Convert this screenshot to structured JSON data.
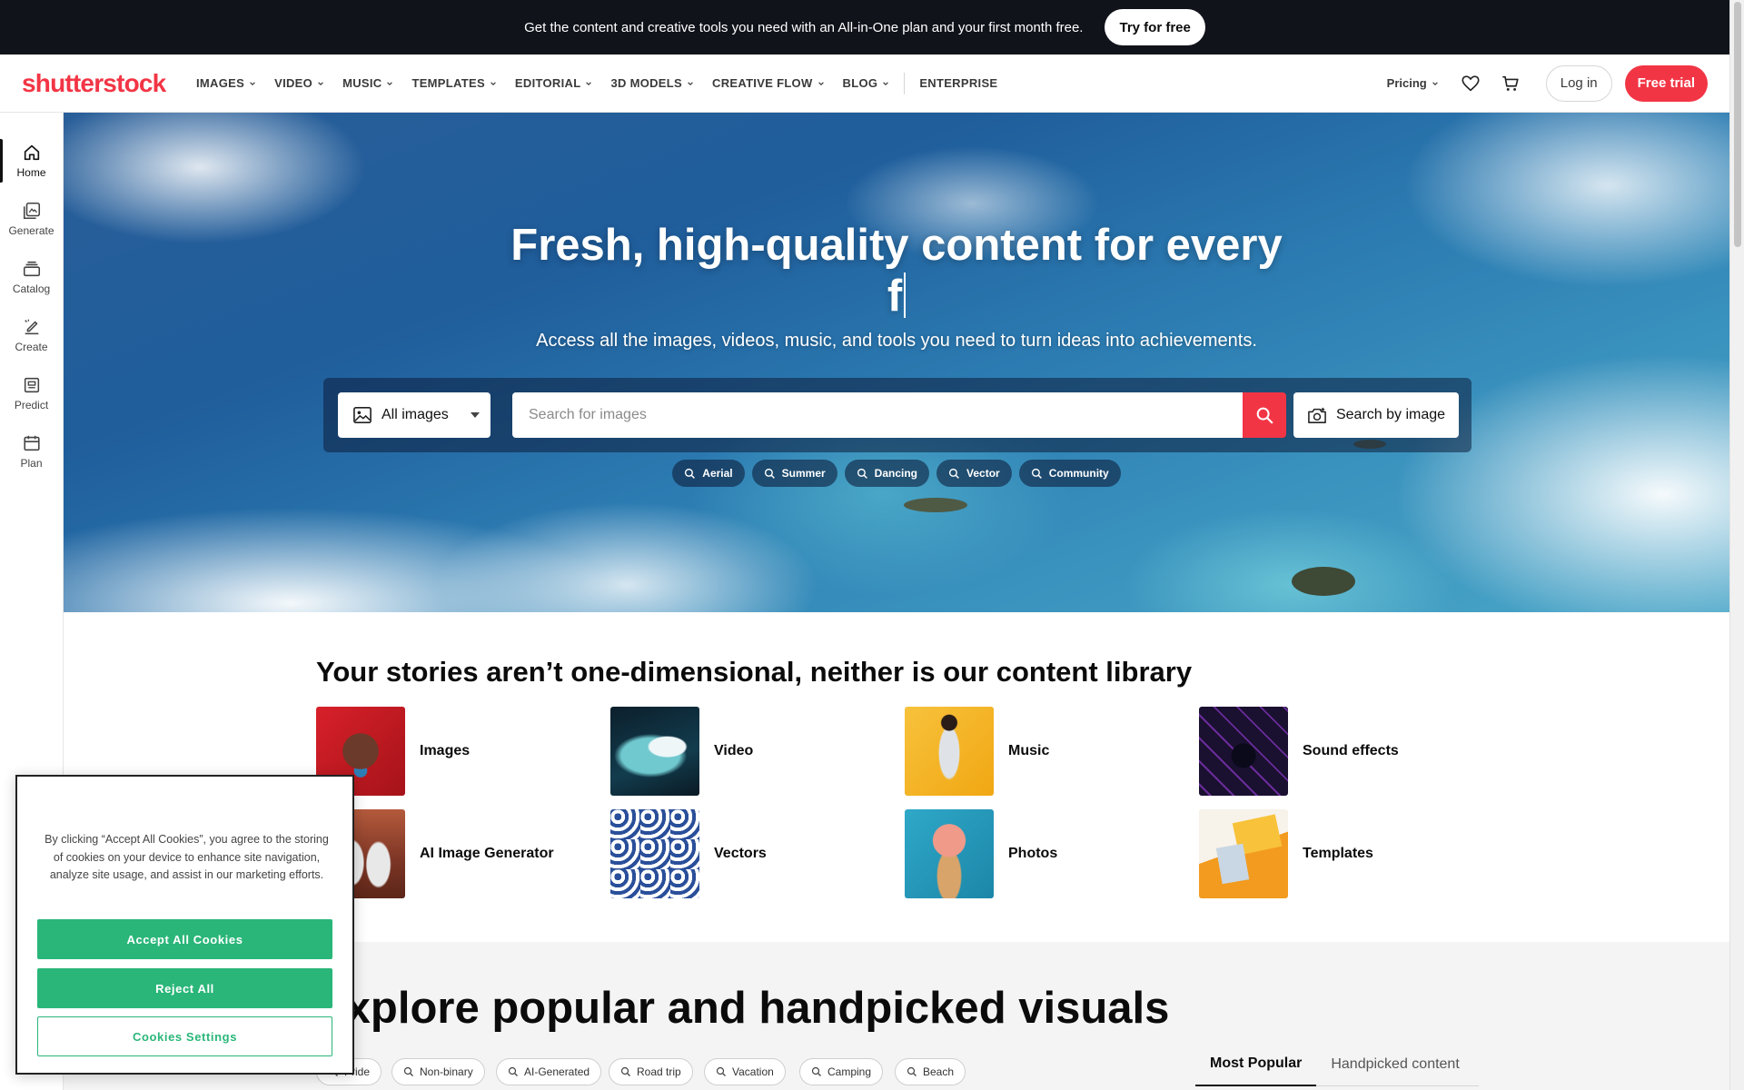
{
  "promo": {
    "text": "Get the content and creative tools you need with an All-in-One plan and your first month free.",
    "button": "Try for free"
  },
  "header": {
    "logo": "shutterstock",
    "nav": [
      "IMAGES",
      "VIDEO",
      "MUSIC",
      "TEMPLATES",
      "EDITORIAL",
      "3D MODELS",
      "CREATIVE FLOW",
      "BLOG"
    ],
    "enterprise": "ENTERPRISE",
    "pricing": "Pricing",
    "login": "Log in",
    "free_trial": "Free trial"
  },
  "sidebar": {
    "items": [
      {
        "label": "Home",
        "icon": "home-icon"
      },
      {
        "label": "Generate",
        "icon": "generate-icon"
      },
      {
        "label": "Catalog",
        "icon": "catalog-icon"
      },
      {
        "label": "Create",
        "icon": "create-icon"
      },
      {
        "label": "Predict",
        "icon": "predict-icon"
      },
      {
        "label": "Plan",
        "icon": "plan-icon"
      }
    ]
  },
  "hero": {
    "title_line1": "Fresh, high-quality content for every",
    "title_line2": "f",
    "subtitle": "Access all the images, videos, music, and tools you need to turn ideas into achievements.",
    "type_select": "All images",
    "search_placeholder": "Search for images",
    "search_by_image": "Search by image",
    "chips": [
      "Aerial",
      "Summer",
      "Dancing",
      "Vector",
      "Community"
    ]
  },
  "categories": {
    "title": "Your stories aren’t one-dimensional, neither is our content library",
    "items": [
      {
        "label": "Images"
      },
      {
        "label": "Video"
      },
      {
        "label": "Music"
      },
      {
        "label": "Sound effects"
      },
      {
        "label": "AI Image Generator"
      },
      {
        "label": "Vectors"
      },
      {
        "label": "Photos"
      },
      {
        "label": "Templates"
      }
    ]
  },
  "explore": {
    "title": "Explore popular and handpicked visuals",
    "tags": [
      "Pride",
      "Non-binary",
      "AI-Generated",
      "Road trip",
      "Vacation",
      "Camping",
      "Beach"
    ],
    "tabs": [
      "Most Popular",
      "Handpicked content"
    ]
  },
  "cookie": {
    "text": "By clicking “Accept All Cookies”, you agree to the storing of cookies on your device to enhance site navigation, analyze site usage, and assist in our marketing efforts.",
    "accept": "Accept All Cookies",
    "reject": "Reject All",
    "settings": "Cookies Settings"
  },
  "colors": {
    "brand": "#f23545",
    "cookie_accent": "#2ab679",
    "promo_bg": "#10131a"
  }
}
